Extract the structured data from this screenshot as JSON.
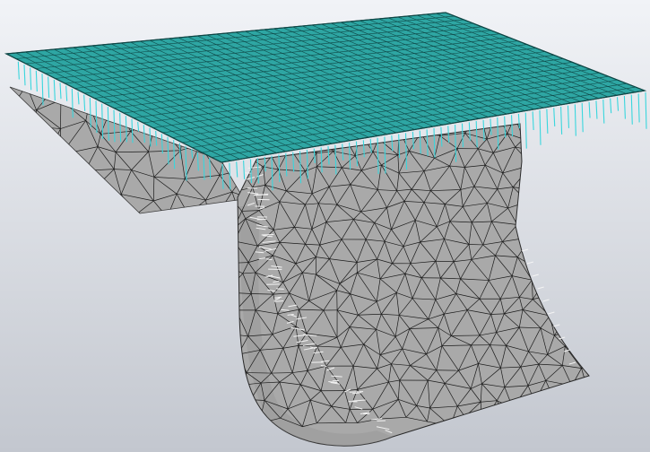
{
  "viewport": {
    "background_top": "#f1f3f7",
    "background_bottom": "#c3c7cf"
  },
  "model": {
    "plate_color": "#2ea6a3",
    "plate_edge_color": "#0f4746",
    "body_color": "#a9a9a9",
    "body_shadow_color": "#8f8f8f",
    "mesh_line_color": "#1b1b1b",
    "load_arrow_color": "#39d6dd",
    "fixture_arrow_color": "#f4f4f4"
  }
}
